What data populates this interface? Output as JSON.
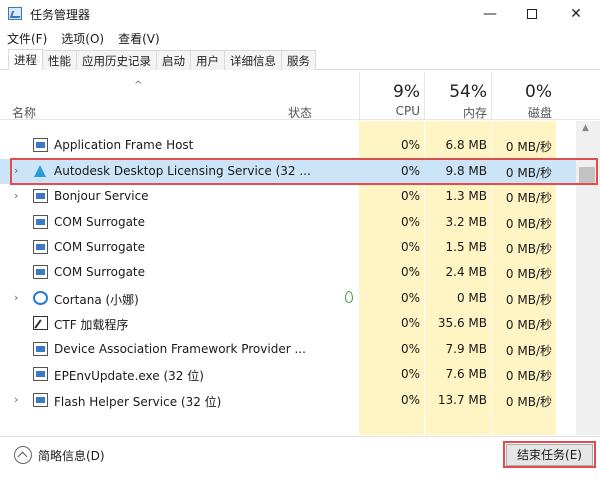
{
  "window": {
    "title": "任务管理器",
    "controls": {
      "minimize": "—",
      "close": "✕"
    }
  },
  "menu": [
    {
      "label": "文件(F)"
    },
    {
      "label": "选项(O)"
    },
    {
      "label": "查看(V)"
    }
  ],
  "tabs": [
    {
      "label": "进程",
      "active": true
    },
    {
      "label": "性能"
    },
    {
      "label": "应用历史记录"
    },
    {
      "label": "启动"
    },
    {
      "label": "用户"
    },
    {
      "label": "详细信息"
    },
    {
      "label": "服务"
    }
  ],
  "columns": {
    "sort_arrow": "^",
    "name": "名称",
    "status": "状态",
    "cpu": {
      "pct": "9%",
      "label": "CPU"
    },
    "memory": {
      "pct": "54%",
      "label": "内存"
    },
    "disk": {
      "pct": "0%",
      "label": "磁盘"
    }
  },
  "processes": [
    {
      "name": "Application Frame Host",
      "cpu": "0%",
      "mem": "6.8 MB",
      "disk": "0 MB/秒",
      "expandable": false
    },
    {
      "name": "Autodesk Desktop Licensing Service (32 ...",
      "cpu": "0%",
      "mem": "9.8 MB",
      "disk": "0 MB/秒",
      "expandable": true,
      "selected": true
    },
    {
      "name": "Bonjour Service",
      "cpu": "0%",
      "mem": "1.3 MB",
      "disk": "0 MB/秒",
      "expandable": true
    },
    {
      "name": "COM Surrogate",
      "cpu": "0%",
      "mem": "3.2 MB",
      "disk": "0 MB/秒",
      "expandable": false
    },
    {
      "name": "COM Surrogate",
      "cpu": "0%",
      "mem": "1.5 MB",
      "disk": "0 MB/秒",
      "expandable": false
    },
    {
      "name": "COM Surrogate",
      "cpu": "0%",
      "mem": "2.4 MB",
      "disk": "0 MB/秒",
      "expandable": false
    },
    {
      "name": "Cortana (小娜)",
      "cpu": "0%",
      "mem": "0 MB",
      "disk": "0 MB/秒",
      "expandable": true,
      "status_icon": "leaf-icon"
    },
    {
      "name": "CTF 加载程序",
      "cpu": "0%",
      "mem": "35.6 MB",
      "disk": "0 MB/秒",
      "expandable": false
    },
    {
      "name": "Device Association Framework Provider ...",
      "cpu": "0%",
      "mem": "7.9 MB",
      "disk": "0 MB/秒",
      "expandable": false
    },
    {
      "name": "EPEnvUpdate.exe (32 位)",
      "cpu": "0%",
      "mem": "7.6 MB",
      "disk": "0 MB/秒",
      "expandable": false
    },
    {
      "name": "Flash Helper Service (32 位)",
      "cpu": "0%",
      "mem": "13.7 MB",
      "disk": "0 MB/秒",
      "expandable": true
    }
  ],
  "footer": {
    "brief_label": "简略信息(D)",
    "end_task_label": "结束任务(E)"
  },
  "colors": {
    "highlight_column": "#fff4c4",
    "selected_row": "#cce4f7",
    "annotation_box": "#e14d4d"
  }
}
